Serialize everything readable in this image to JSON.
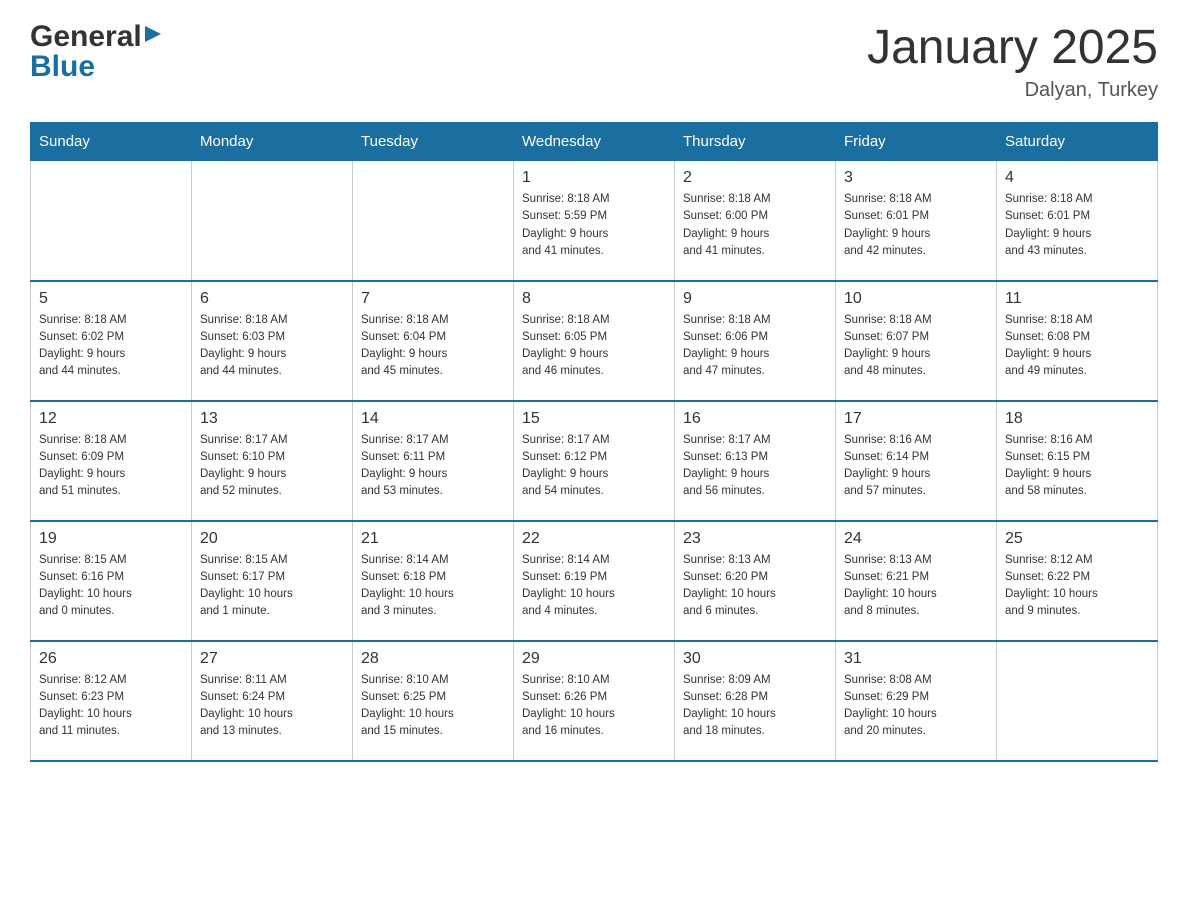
{
  "logo": {
    "general": "General",
    "blue": "Blue"
  },
  "header": {
    "title": "January 2025",
    "location": "Dalyan, Turkey"
  },
  "days": [
    "Sunday",
    "Monday",
    "Tuesday",
    "Wednesday",
    "Thursday",
    "Friday",
    "Saturday"
  ],
  "weeks": [
    [
      {
        "day": "",
        "info": ""
      },
      {
        "day": "",
        "info": ""
      },
      {
        "day": "",
        "info": ""
      },
      {
        "day": "1",
        "info": "Sunrise: 8:18 AM\nSunset: 5:59 PM\nDaylight: 9 hours\nand 41 minutes."
      },
      {
        "day": "2",
        "info": "Sunrise: 8:18 AM\nSunset: 6:00 PM\nDaylight: 9 hours\nand 41 minutes."
      },
      {
        "day": "3",
        "info": "Sunrise: 8:18 AM\nSunset: 6:01 PM\nDaylight: 9 hours\nand 42 minutes."
      },
      {
        "day": "4",
        "info": "Sunrise: 8:18 AM\nSunset: 6:01 PM\nDaylight: 9 hours\nand 43 minutes."
      }
    ],
    [
      {
        "day": "5",
        "info": "Sunrise: 8:18 AM\nSunset: 6:02 PM\nDaylight: 9 hours\nand 44 minutes."
      },
      {
        "day": "6",
        "info": "Sunrise: 8:18 AM\nSunset: 6:03 PM\nDaylight: 9 hours\nand 44 minutes."
      },
      {
        "day": "7",
        "info": "Sunrise: 8:18 AM\nSunset: 6:04 PM\nDaylight: 9 hours\nand 45 minutes."
      },
      {
        "day": "8",
        "info": "Sunrise: 8:18 AM\nSunset: 6:05 PM\nDaylight: 9 hours\nand 46 minutes."
      },
      {
        "day": "9",
        "info": "Sunrise: 8:18 AM\nSunset: 6:06 PM\nDaylight: 9 hours\nand 47 minutes."
      },
      {
        "day": "10",
        "info": "Sunrise: 8:18 AM\nSunset: 6:07 PM\nDaylight: 9 hours\nand 48 minutes."
      },
      {
        "day": "11",
        "info": "Sunrise: 8:18 AM\nSunset: 6:08 PM\nDaylight: 9 hours\nand 49 minutes."
      }
    ],
    [
      {
        "day": "12",
        "info": "Sunrise: 8:18 AM\nSunset: 6:09 PM\nDaylight: 9 hours\nand 51 minutes."
      },
      {
        "day": "13",
        "info": "Sunrise: 8:17 AM\nSunset: 6:10 PM\nDaylight: 9 hours\nand 52 minutes."
      },
      {
        "day": "14",
        "info": "Sunrise: 8:17 AM\nSunset: 6:11 PM\nDaylight: 9 hours\nand 53 minutes."
      },
      {
        "day": "15",
        "info": "Sunrise: 8:17 AM\nSunset: 6:12 PM\nDaylight: 9 hours\nand 54 minutes."
      },
      {
        "day": "16",
        "info": "Sunrise: 8:17 AM\nSunset: 6:13 PM\nDaylight: 9 hours\nand 56 minutes."
      },
      {
        "day": "17",
        "info": "Sunrise: 8:16 AM\nSunset: 6:14 PM\nDaylight: 9 hours\nand 57 minutes."
      },
      {
        "day": "18",
        "info": "Sunrise: 8:16 AM\nSunset: 6:15 PM\nDaylight: 9 hours\nand 58 minutes."
      }
    ],
    [
      {
        "day": "19",
        "info": "Sunrise: 8:15 AM\nSunset: 6:16 PM\nDaylight: 10 hours\nand 0 minutes."
      },
      {
        "day": "20",
        "info": "Sunrise: 8:15 AM\nSunset: 6:17 PM\nDaylight: 10 hours\nand 1 minute."
      },
      {
        "day": "21",
        "info": "Sunrise: 8:14 AM\nSunset: 6:18 PM\nDaylight: 10 hours\nand 3 minutes."
      },
      {
        "day": "22",
        "info": "Sunrise: 8:14 AM\nSunset: 6:19 PM\nDaylight: 10 hours\nand 4 minutes."
      },
      {
        "day": "23",
        "info": "Sunrise: 8:13 AM\nSunset: 6:20 PM\nDaylight: 10 hours\nand 6 minutes."
      },
      {
        "day": "24",
        "info": "Sunrise: 8:13 AM\nSunset: 6:21 PM\nDaylight: 10 hours\nand 8 minutes."
      },
      {
        "day": "25",
        "info": "Sunrise: 8:12 AM\nSunset: 6:22 PM\nDaylight: 10 hours\nand 9 minutes."
      }
    ],
    [
      {
        "day": "26",
        "info": "Sunrise: 8:12 AM\nSunset: 6:23 PM\nDaylight: 10 hours\nand 11 minutes."
      },
      {
        "day": "27",
        "info": "Sunrise: 8:11 AM\nSunset: 6:24 PM\nDaylight: 10 hours\nand 13 minutes."
      },
      {
        "day": "28",
        "info": "Sunrise: 8:10 AM\nSunset: 6:25 PM\nDaylight: 10 hours\nand 15 minutes."
      },
      {
        "day": "29",
        "info": "Sunrise: 8:10 AM\nSunset: 6:26 PM\nDaylight: 10 hours\nand 16 minutes."
      },
      {
        "day": "30",
        "info": "Sunrise: 8:09 AM\nSunset: 6:28 PM\nDaylight: 10 hours\nand 18 minutes."
      },
      {
        "day": "31",
        "info": "Sunrise: 8:08 AM\nSunset: 6:29 PM\nDaylight: 10 hours\nand 20 minutes."
      },
      {
        "day": "",
        "info": ""
      }
    ]
  ]
}
